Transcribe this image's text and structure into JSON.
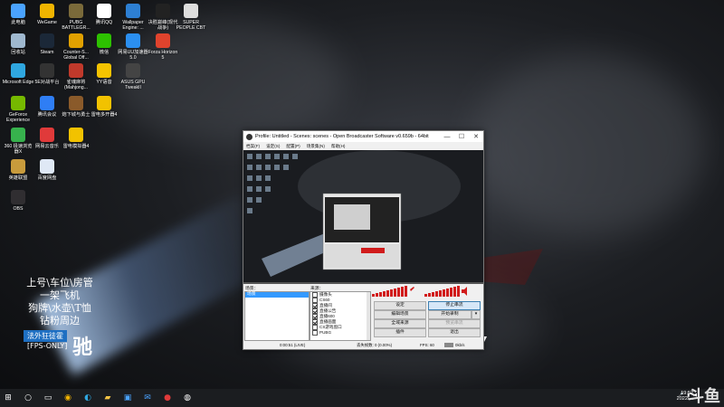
{
  "desktop": {
    "icons": [
      {
        "label": "此电脑",
        "icon": "computer-icon",
        "color": "#4aa3ff"
      },
      {
        "label": "WeGame",
        "icon": "wegame-icon",
        "color": "#f0b400"
      },
      {
        "label": "PUBG BATTLEGR...",
        "icon": "pubg-icon",
        "color": "#7a6a3a"
      },
      {
        "label": "腾讯QQ",
        "icon": "qq-icon",
        "color": "#ffffff"
      },
      {
        "label": "Wallpaper Engine: ...",
        "icon": "wallpaper-engine-icon",
        "color": "#2d7fd3"
      },
      {
        "label": "决胜巅峰(现代战争)",
        "icon": "mw-icon",
        "color": "#222222"
      },
      {
        "label": "SUPER PEOPLE CBT",
        "icon": "superpeople-icon",
        "color": "#dddddd"
      },
      {
        "label": "回收站",
        "icon": "recycle-bin-icon",
        "color": "#9fb8cf"
      },
      {
        "label": "Steam",
        "icon": "steam-icon",
        "color": "#1b2838"
      },
      {
        "label": "Counter-S... Global Off...",
        "icon": "csgo-icon",
        "color": "#e0a000"
      },
      {
        "label": "微信",
        "icon": "wechat-icon",
        "color": "#2dc100"
      },
      {
        "label": "网易UU加速器5.0",
        "icon": "uu-icon",
        "color": "#2b8ff0"
      },
      {
        "label": "Forza Horizon 5",
        "icon": "forza-icon",
        "color": "#e0432d"
      },
      {
        "label": "Microsoft Edge",
        "icon": "edge-icon",
        "color": "#2fa7e0"
      },
      {
        "label": "5E对战平台",
        "icon": "5e-icon",
        "color": "#333333"
      },
      {
        "label": "雀魂麻将(Mahjong...",
        "icon": "mahjong-icon",
        "color": "#c0392b"
      },
      {
        "label": "YY语音",
        "icon": "yy-icon",
        "color": "#f5c300"
      },
      {
        "label": "ASUS GPU TweakII",
        "icon": "asus-gpu-icon",
        "color": "#444444"
      },
      {
        "label": "GeForce Experience",
        "icon": "geforce-icon",
        "color": "#76b900"
      },
      {
        "label": "腾讯会议",
        "icon": "tencent-meeting-icon",
        "color": "#2f7ef5"
      },
      {
        "label": "炮下城与勇士",
        "icon": "dnf-icon",
        "color": "#8a5a2a"
      },
      {
        "label": "雷电多开器4",
        "icon": "ldplayer-icon",
        "color": "#f2c200"
      },
      {
        "label": "360 极速浏览器X",
        "icon": "360-browser-icon",
        "color": "#37b24d"
      },
      {
        "label": "网易云音乐",
        "icon": "netease-music-icon",
        "color": "#e03a3a"
      },
      {
        "label": "雷电模拟器4",
        "icon": "ld-emulator-icon",
        "color": "#f2c200"
      },
      {
        "label": "英雄联盟",
        "icon": "lol-icon",
        "color": "#c89b3c"
      },
      {
        "label": "百度网盘",
        "icon": "baidu-netdisk-icon",
        "color": "#dfe8f5"
      },
      {
        "label": "OBS",
        "icon": "obs-icon",
        "color": "#302e31"
      }
    ]
  },
  "overlay": {
    "lines": [
      "上号\\车位\\房管",
      "一架飞机",
      "狗牌\\水壶\\T恤",
      "钻粉周边"
    ],
    "fans_badge": "法外狂徒霍",
    "fps_only": "[FPS-ONLY]",
    "hud_logo": "驰"
  },
  "obs": {
    "title": "Profile: Untitled - Scenes: scenes - Open Broadcaster Software v0.659b - 64bit",
    "window_buttons": [
      "—",
      "☐",
      "✕"
    ],
    "menu": [
      "档案(F)",
      "设定(S)",
      "配置(P)",
      "场景集(N)",
      "帮助(H)"
    ],
    "scenes_header": "场景：",
    "sources_header": "来源：",
    "scenes": [
      "场景"
    ],
    "sources": [
      {
        "name": "摄像头",
        "checked": false
      },
      {
        "name": "CS60",
        "checked": false
      },
      {
        "name": "直播间",
        "checked": true
      },
      {
        "name": "直播公告",
        "checked": true
      },
      {
        "name": "直播600",
        "checked": true
      },
      {
        "name": "直播画面",
        "checked": true
      },
      {
        "name": "CS游戏窗口",
        "checked": false
      },
      {
        "name": "PUBG",
        "checked": false
      }
    ],
    "buttons": [
      {
        "label": "设定",
        "name": "settings-button",
        "state": "normal"
      },
      {
        "label": "停止串流",
        "name": "stop-stream-button",
        "state": "primary"
      },
      {
        "label": "编辑场景",
        "name": "edit-scene-button",
        "state": "normal"
      },
      {
        "label": "开始录制",
        "name": "start-recording-button",
        "state": "normal"
      },
      {
        "label": "全域来源",
        "name": "global-sources-button",
        "state": "normal"
      },
      {
        "label": "预览串流",
        "name": "preview-stream-button",
        "state": "disabled"
      },
      {
        "label": "插件",
        "name": "plugins-button",
        "state": "normal"
      },
      {
        "label": "退出",
        "name": "exit-button",
        "state": "normal"
      }
    ],
    "status": {
      "time": "0:00:51 (LIVE)",
      "dropped": "丢失帧数: 0 (0.00%)",
      "fps": "FPS: 60",
      "bitrate": "0kb/s"
    }
  },
  "taskbar": {
    "items": [
      "start-icon",
      "search-icon",
      "chrome-icon",
      "edge-icon",
      "file-explorer-icon",
      "store-icon",
      "mail-icon",
      "netease-icon",
      "obs-icon"
    ],
    "clock_time": "19:52",
    "clock_date": "2022/..."
  },
  "watermark": "斗鱼",
  "colors": {
    "accent": "#1e6fc2",
    "meter_red": "#d11b1b",
    "selection": "#3399ff"
  }
}
